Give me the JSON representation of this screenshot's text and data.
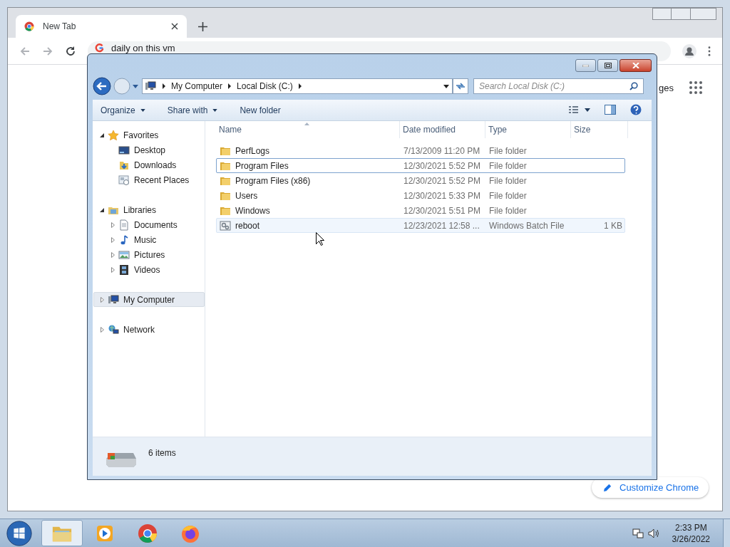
{
  "browser": {
    "tab": {
      "title": "New Tab"
    },
    "omnibox": {
      "value": "daily on this vm"
    },
    "shortcut_fragment": "ges",
    "customize_button": "Customize Chrome"
  },
  "explorer": {
    "breadcrumbs": [
      "My Computer",
      "Local Disk (C:)"
    ],
    "search": {
      "placeholder": "Search Local Disk (C:)"
    },
    "toolbar": [
      {
        "label": "Organize",
        "dropdown": true
      },
      {
        "label": "Share with",
        "dropdown": true
      },
      {
        "label": "New folder",
        "dropdown": false
      }
    ],
    "nav": [
      {
        "label": "Favorites",
        "kind": "star",
        "expanded": true,
        "selected": false,
        "children": [
          {
            "label": "Desktop",
            "kind": "desktop"
          },
          {
            "label": "Downloads",
            "kind": "downloads"
          },
          {
            "label": "Recent Places",
            "kind": "recent"
          }
        ]
      },
      {
        "label": "Libraries",
        "kind": "library",
        "expanded": true,
        "selected": false,
        "children": [
          {
            "label": "Documents",
            "kind": "documents",
            "expanded": false
          },
          {
            "label": "Music",
            "kind": "music",
            "expanded": false
          },
          {
            "label": "Pictures",
            "kind": "pictures",
            "expanded": false
          },
          {
            "label": "Videos",
            "kind": "videos",
            "expanded": false
          }
        ]
      },
      {
        "label": "My Computer",
        "kind": "computer",
        "expanded": false,
        "selected": true
      },
      {
        "label": "Network",
        "kind": "network",
        "expanded": false,
        "selected": false
      }
    ],
    "columns": [
      "Name",
      "Date modified",
      "Type",
      "Size"
    ],
    "rows": [
      {
        "name": "PerfLogs",
        "date": "7/13/2009 11:20 PM",
        "type": "File folder",
        "kind": "folder",
        "focused": false,
        "hovered": false
      },
      {
        "name": "Program Files",
        "date": "12/30/2021 5:52 PM",
        "type": "File folder",
        "kind": "folder",
        "focused": true,
        "hovered": false
      },
      {
        "name": "Program Files (x86)",
        "date": "12/30/2021 5:52 PM",
        "type": "File folder",
        "kind": "folder",
        "focused": false,
        "hovered": false
      },
      {
        "name": "Users",
        "date": "12/30/2021 5:33 PM",
        "type": "File folder",
        "kind": "folder",
        "focused": false,
        "hovered": false
      },
      {
        "name": "Windows",
        "date": "12/30/2021 5:51 PM",
        "type": "File folder",
        "kind": "folder",
        "focused": false,
        "hovered": false
      },
      {
        "name": "reboot",
        "date": "12/23/2021 12:58 ...",
        "type": "Windows Batch File",
        "size": "1 KB",
        "kind": "batch",
        "focused": false,
        "hovered": true
      }
    ],
    "status": "6 items"
  },
  "taskbar": {
    "apps": [
      {
        "kind": "explorer",
        "active": true
      },
      {
        "kind": "media",
        "active": false
      },
      {
        "kind": "chrome",
        "active": false
      },
      {
        "kind": "firefox",
        "active": false
      }
    ],
    "time": "2:33 PM",
    "date": "3/26/2022"
  }
}
